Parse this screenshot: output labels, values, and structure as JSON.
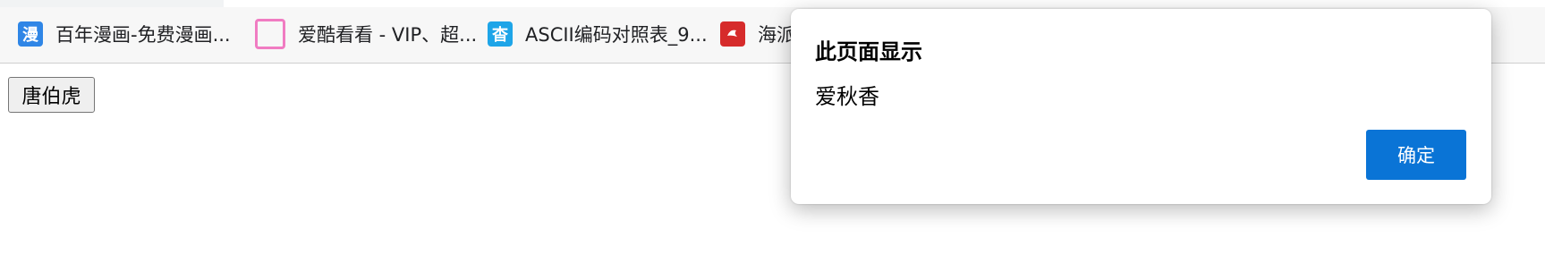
{
  "bookmarks": [
    {
      "icon": "manga-icon",
      "icon_glyph": "漫",
      "label": "百年漫画-免费漫画..."
    },
    {
      "icon": "aiku-icon",
      "icon_glyph": "",
      "label": "爱酷看看 - VIP、超..."
    },
    {
      "icon": "ascii-icon",
      "icon_glyph": "杳",
      "label": "ASCII编码对照表_9..."
    },
    {
      "icon": "hai-icon",
      "icon_glyph": "",
      "label": "海派"
    }
  ],
  "page": {
    "button_label": "唐伯虎"
  },
  "dialog": {
    "title": "此页面显示",
    "message": "爱秋香",
    "ok_label": "确定"
  },
  "colors": {
    "accent": "#0a74d6",
    "bookmarks_bg": "#f7f7f7"
  }
}
